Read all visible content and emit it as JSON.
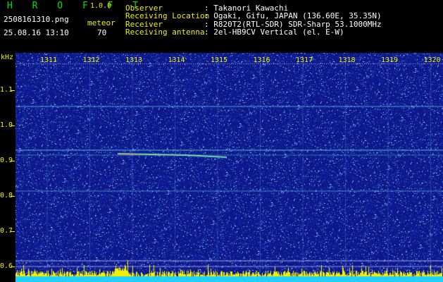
{
  "app": {
    "title": "H R O F F T",
    "version": "1.0.0"
  },
  "file": {
    "name": "2508161310.png",
    "datetime": "25.08.16 13:10"
  },
  "detector": {
    "label": "meteor",
    "count": "70"
  },
  "info": [
    {
      "key": "Observer",
      "value": ": Takanori Kawachi"
    },
    {
      "key": "Receiving Location",
      "value": ": Ogaki, Gifu, JAPAN (136.60E, 35.35N)"
    },
    {
      "key": "Receiver",
      "value": ": R820T2(RTL-SDR) SDR-Sharp 53.1000MHz"
    },
    {
      "key": "Receiving antenna",
      "value": ": 2el-HB9CV Vertical (el. E-W)"
    }
  ],
  "axis": {
    "y_unit": "kHz",
    "y_ticks": [
      "1.1",
      "1.0",
      "0.9",
      "0.8",
      "0.7",
      "0.6"
    ],
    "x_ticks": [
      "1311",
      "1312",
      "1313",
      "1314",
      "1315",
      "1316",
      "1317",
      "1318",
      "1319",
      "1320"
    ]
  },
  "colors": {
    "background": "#101a80",
    "text_yellow": "#f0f000",
    "title_green": "#00e000",
    "signal": "#4fd0e0"
  }
}
